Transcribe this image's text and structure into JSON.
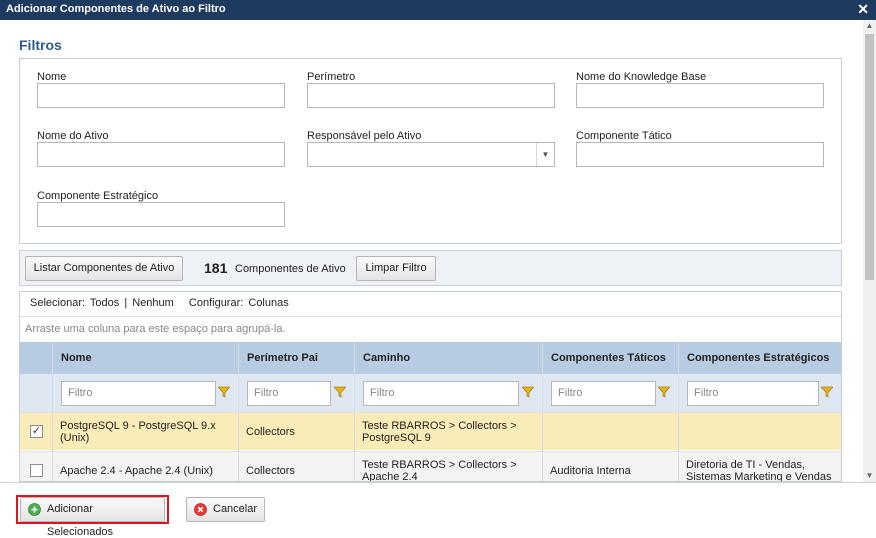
{
  "dialog": {
    "title": "Adicionar Componentes de Ativo ao Filtro",
    "close_glyph": "✕"
  },
  "filters": {
    "section_title": "Filtros",
    "fields": [
      {
        "label": "Nome",
        "value": ""
      },
      {
        "label": "Perímetro",
        "value": ""
      },
      {
        "label": "Nome do Knowledge Base",
        "value": ""
      },
      {
        "label": "Nome do Ativo",
        "value": ""
      },
      {
        "label": "Responsável pelo Ativo",
        "value": ""
      },
      {
        "label": "Componente Tático",
        "value": ""
      },
      {
        "label": "Componente Estratégico",
        "value": ""
      }
    ]
  },
  "toolbar": {
    "list_button": "Listar Componentes de Ativo",
    "count": "181",
    "count_label": "Componentes de Ativo",
    "clear_button": "Limpar Filtro"
  },
  "grid": {
    "select_label": "Selecionar:",
    "select_all": "Todos",
    "separator": "|",
    "select_none": "Nenhum",
    "configure_label": "Configurar:",
    "configure_columns": "Colunas",
    "group_hint": "Arraste uma coluna para este espaço para agrupá-la.",
    "columns": [
      "Nome",
      "Perímetro Pai",
      "Caminho",
      "Componentes Táticos",
      "Componentes Estratégicos"
    ],
    "filter_placeholder": "Filtro",
    "rows": [
      {
        "checked": true,
        "nome": "PostgreSQL 9 - PostgreSQL 9.x (Unix)",
        "perimetro": "Collectors",
        "caminho": "Teste RBARROS > Collectors > PostgreSQL 9",
        "taticos": "",
        "estrategicos": ""
      },
      {
        "checked": false,
        "nome": "Apache 2.4 - Apache 2.4 (Unix)",
        "perimetro": "Collectors",
        "caminho": "Teste RBARROS > Collectors > Apache 2.4",
        "taticos": "Auditoria Interna",
        "estrategicos": "Diretoria de TI - Vendas, Sistemas Marketing e Vendas"
      }
    ]
  },
  "footer": {
    "add_button": "Adicionar Selecionados",
    "cancel_button": "Cancelar"
  },
  "colors": {
    "titlebar": "#1e3a5f",
    "accent_title": "#2c5c8c",
    "header_bg": "#b7cce3",
    "selected_row": "#faecb8",
    "highlight_border": "#e0141e",
    "add_icon": "#4caf50",
    "cancel_icon": "#e53935"
  },
  "icons": {
    "close": "close-icon",
    "dropdown": "chevron-down-icon",
    "filter": "funnel-icon",
    "add": "plus-circle-icon",
    "cancel": "x-circle-icon"
  }
}
